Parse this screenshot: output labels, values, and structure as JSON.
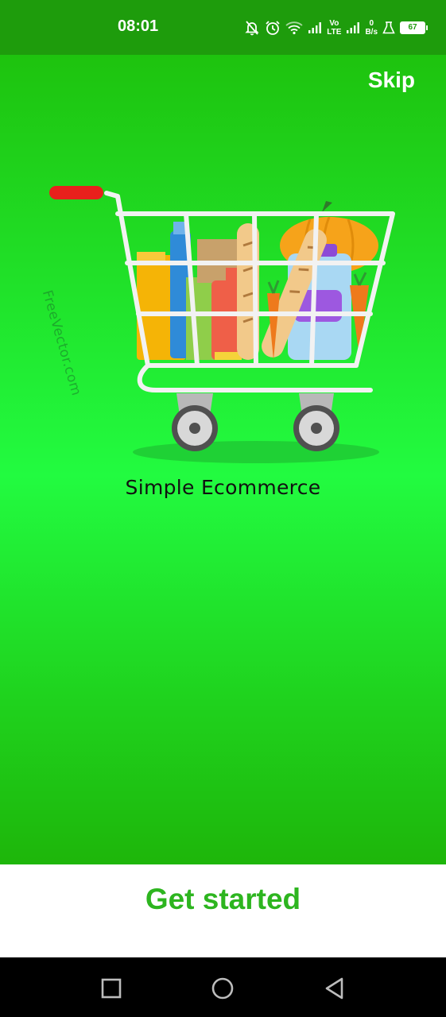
{
  "status_bar": {
    "time": "08:01",
    "network_label_top": "Vo",
    "network_label_bottom": "LTE",
    "data_speed_value": "0",
    "data_speed_unit": "B/s",
    "battery_level": "67",
    "icons": [
      "bell-off-icon",
      "alarm-icon",
      "wifi-icon",
      "signal-icon",
      "volte-icon",
      "signal-icon",
      "data-speed",
      "lab-icon",
      "battery-icon"
    ]
  },
  "onboarding": {
    "skip_label": "Skip",
    "watermark": "FreeVector.com",
    "brand_caption": "Simple Ecommerce",
    "illustration": "shopping-cart-with-groceries"
  },
  "cta": {
    "get_started_label": "Get started"
  },
  "nav_bar": {
    "icons": [
      "recent-apps-icon",
      "home-icon",
      "back-icon"
    ]
  },
  "colors": {
    "status_bar": "#1e9c0c",
    "background_top": "#1ec30e",
    "background_mid": "#22fb40",
    "background_bottom": "#1eb60a",
    "accent": "#2db51f",
    "cart_handle": "#e8201c"
  }
}
